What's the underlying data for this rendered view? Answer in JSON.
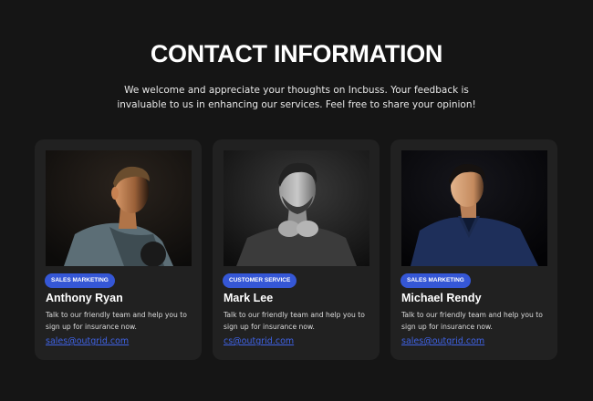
{
  "header": {
    "title": "CONTACT INFORMATION",
    "subtitle": "We welcome and appreciate your thoughts on Incbuss. Your feedback is invaluable to us in enhancing our services. Feel free to share your opinion!"
  },
  "colors": {
    "background": "#151515",
    "card": "#212121",
    "badge": "#3557d6",
    "link": "#3f63e6"
  },
  "cards": [
    {
      "badge": "SALES MARKETING",
      "name": "Anthony Ryan",
      "description": "Talk to our friendly team and help you to sign up for insurance now.",
      "email": "sales@outgrid.com",
      "photo": "portrait-anthony-ryan"
    },
    {
      "badge": "CUSTOMER SERVICE",
      "name": "Mark Lee",
      "description": "Talk to our friendly team and help you to sign up for insurance now.",
      "email": "cs@outgrid.com",
      "photo": "portrait-mark-lee"
    },
    {
      "badge": "SALES MARKETING",
      "name": "Michael Rendy",
      "description": "Talk to our friendly team and help you to sign up for insurance now.",
      "email": "sales@outgrid.com",
      "photo": "portrait-michael-rendy"
    }
  ]
}
